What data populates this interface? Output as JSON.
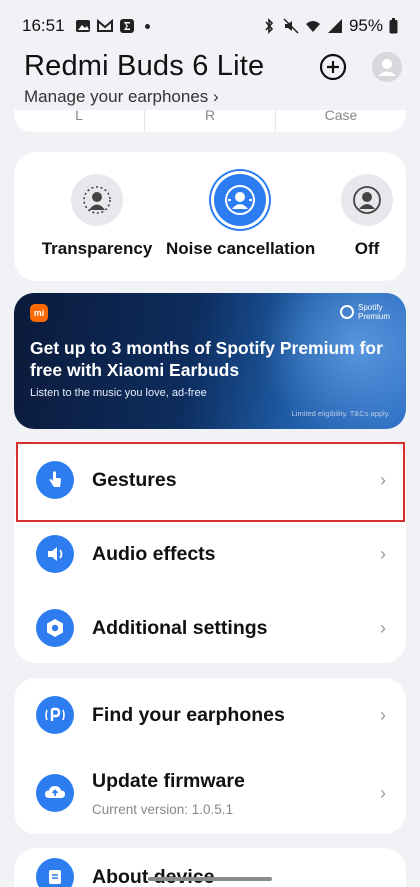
{
  "status_bar": {
    "time": "16:51",
    "battery": "95%"
  },
  "header": {
    "title": "Redmi Buds 6 Lite",
    "subtitle": "Manage your earphones",
    "subtitle_chevron": "›"
  },
  "battery_labels": [
    "L",
    "R",
    "Case"
  ],
  "modes": {
    "transparency": "Transparency",
    "noise_cancellation": "Noise cancellation",
    "off": "Off",
    "active": "noise_cancellation"
  },
  "banner": {
    "brand": "mi",
    "partner_line1": "Spotify",
    "partner_line2": "Premium",
    "headline": "Get up to 3 months of Spotify Premium for free with Xiaomi Earbuds",
    "subtext": "Listen to the music you love, ad-free",
    "disclaimer": "Limited eligibility. T&Cs apply."
  },
  "settings": [
    {
      "label": "Gestures",
      "icon": "gesture-icon"
    },
    {
      "label": "Audio effects",
      "icon": "speaker-icon"
    },
    {
      "label": "Additional settings",
      "icon": "settings-hex-icon"
    }
  ],
  "device": [
    {
      "label": "Find your earphones",
      "icon": "find-icon"
    },
    {
      "label": "Update firmware",
      "sub": "Current version: 1.0.5.1",
      "icon": "cloud-upload-icon"
    }
  ],
  "about": {
    "label": "About device"
  },
  "chevron": "›",
  "colors": {
    "accent": "#2e7df0",
    "background": "#f1f2f6",
    "highlight": "#d62d2d"
  }
}
